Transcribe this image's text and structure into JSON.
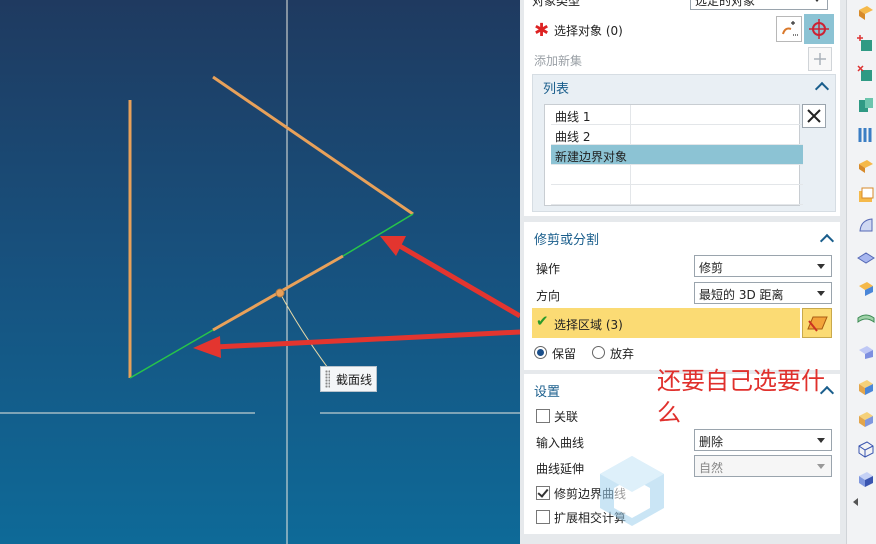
{
  "tooltip": {
    "label": "截面线"
  },
  "panel": {
    "object_type": {
      "label": "对象类型",
      "value": "选定的对象"
    },
    "select_object": {
      "label": "选择对象 (0)"
    },
    "add_new_set": {
      "label": "添加新集"
    },
    "list": {
      "title": "列表",
      "rows": [
        "曲线 1",
        "曲线 2",
        "新建边界对象",
        "",
        ""
      ]
    },
    "trim_split": {
      "title": "修剪或分割",
      "operation_label": "操作",
      "operation_value": "修剪",
      "direction_label": "方向",
      "direction_value": "最短的 3D 距离",
      "select_region": "选择区域 (3)",
      "keep_label": "保留",
      "discard_label": "放弃"
    },
    "settings": {
      "title": "设置",
      "associative_label": "关联",
      "input_curve_label": "输入曲线",
      "input_curve_value": "删除",
      "curve_extension_label": "曲线延伸",
      "curve_extension_value": "自然",
      "trim_boundary_label": "修剪边界曲线",
      "extend_intersect_label": "扩展相交计算"
    }
  },
  "annotation": {
    "text": "还要自己选要什么"
  },
  "colors": {
    "curve": "#e8a15a",
    "highlight": "#27c44a",
    "arrow": "#e3352f",
    "accent": "#1a5e8c",
    "selected_row": "#8cc3d4",
    "region_highlight": "#fbdb74"
  }
}
